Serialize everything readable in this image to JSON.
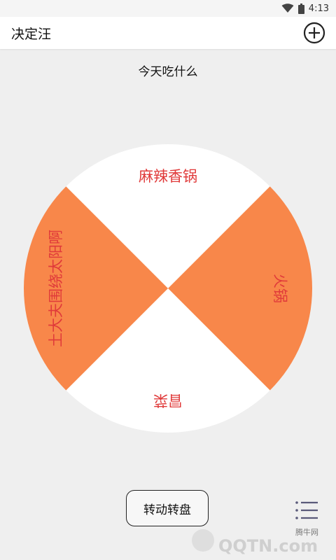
{
  "status_bar": {
    "time": "4:13"
  },
  "app_bar": {
    "title": "决定汪",
    "add_icon": "plus-circle-icon"
  },
  "page": {
    "title": "今天吃什么"
  },
  "wheel": {
    "segments": [
      {
        "label": "麻辣香锅",
        "color": "#ffffff"
      },
      {
        "label": "火锅",
        "color": "#f8874a"
      },
      {
        "label": "冒菜",
        "color": "#ffffff"
      },
      {
        "label": "土大夫围绕太阳啊",
        "color": "#f8874a"
      }
    ],
    "text_color": "#e03a3a"
  },
  "actions": {
    "spin_label": "转动转盘",
    "menu_icon": "list-icon"
  },
  "watermark": {
    "site": "腾牛网",
    "brand": "QQTN.com"
  }
}
